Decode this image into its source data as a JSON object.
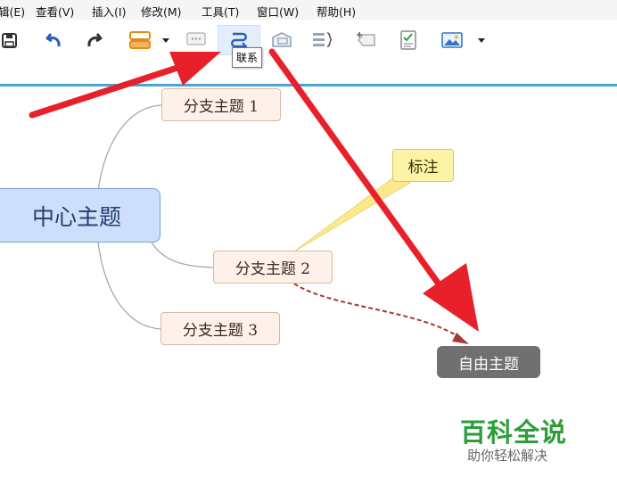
{
  "menu": {
    "edit": "辑(E)",
    "view": "查看(V)",
    "insert": "插入(I)",
    "modify": "修改(M)",
    "tools": "工具(T)",
    "window": "窗口(W)",
    "help": "帮助(H)"
  },
  "toolbar": {
    "tooltip": "联系",
    "active_tool": "relationship-button"
  },
  "mindmap": {
    "central": "中心主题",
    "branch1": "分支主题 1",
    "branch2": "分支主题 2",
    "branch3": "分支主题 3",
    "callout": "标注",
    "floating": "自由主题"
  },
  "watermark": {
    "title": "百科全说",
    "subtitle": "助你轻松解决"
  },
  "colors": {
    "accent_line": "#4aa3d8",
    "central_fill": "#cddffb",
    "branch_fill": "#fdf1ea",
    "callout_fill": "#fdf3a6",
    "floating_fill": "#707070",
    "annotation_arrow": "#e8202a",
    "relationship_line": "#a33a36",
    "watermark_green": "#2d9e3a"
  }
}
